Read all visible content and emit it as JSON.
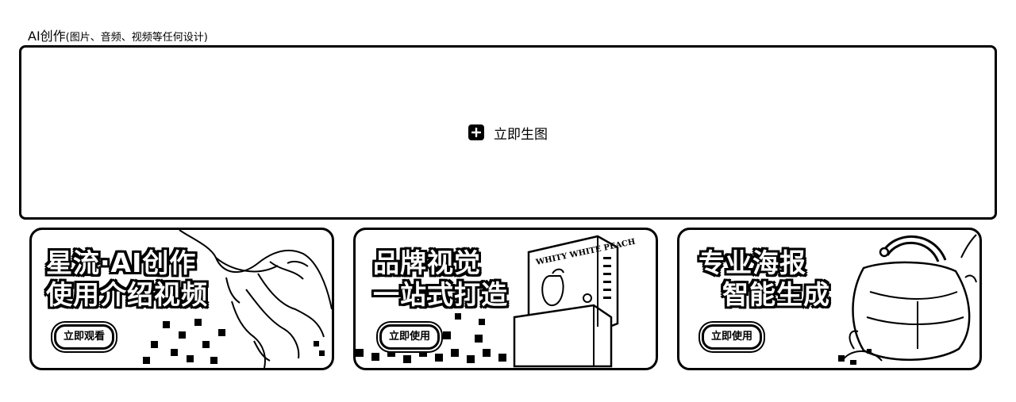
{
  "section": {
    "title": "AI创作",
    "subtitle": "(图片、音频、视频等任何设计)"
  },
  "create": {
    "label": "立即生图",
    "icon": "plus-icon"
  },
  "cards": [
    {
      "line1": "星流·AI创作",
      "line2": "使用介绍视频",
      "button": "立即观看",
      "art": "hand-icon"
    },
    {
      "line1": "品牌视觉",
      "line2": "一站式打造",
      "button": "立即使用",
      "art": "product-box-icon",
      "box_text": "WHITY WHITE PEACH"
    },
    {
      "line1": "专业海报",
      "line2": "智能生成",
      "button": "立即使用",
      "art": "handbag-icon"
    }
  ]
}
